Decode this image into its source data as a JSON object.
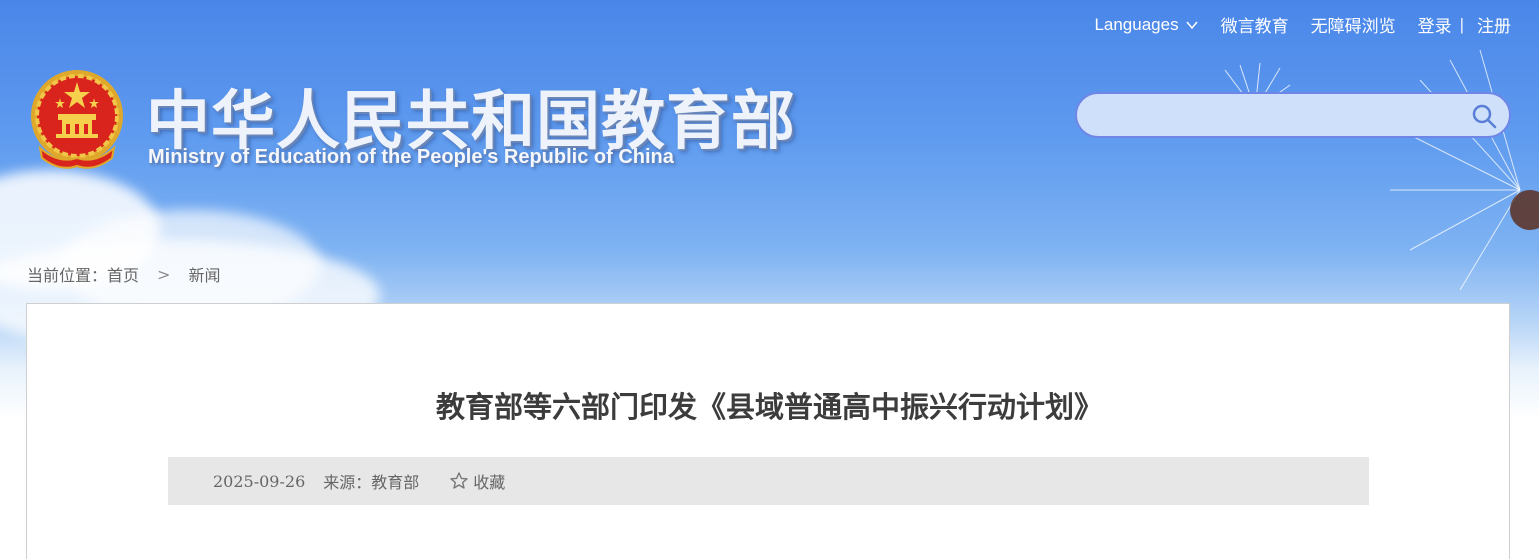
{
  "topnav": {
    "languages_label": "Languages",
    "weiyan_label": "微言教育",
    "accessibility_label": "无障碍浏览",
    "login_label": "登录",
    "separator": "|",
    "register_label": "注册"
  },
  "header": {
    "title_cn": "中华人民共和国教育部",
    "title_en": "Ministry of Education of the People's Republic of China"
  },
  "search": {
    "value": "",
    "placeholder": ""
  },
  "breadcrumb": {
    "prefix": "当前位置：",
    "home": "首页",
    "arrow": ">",
    "current": "新闻"
  },
  "article": {
    "title": "教育部等六部门印发《县域普通高中振兴行动计划》",
    "date": "2025-09-26",
    "source": "来源：教育部",
    "favorite_label": "收藏"
  },
  "colors": {
    "sky_top": "#4a86e8",
    "search_border": "#6f86e6",
    "meta_bg": "#e7e7e7",
    "title_text": "#3c3c3c"
  }
}
